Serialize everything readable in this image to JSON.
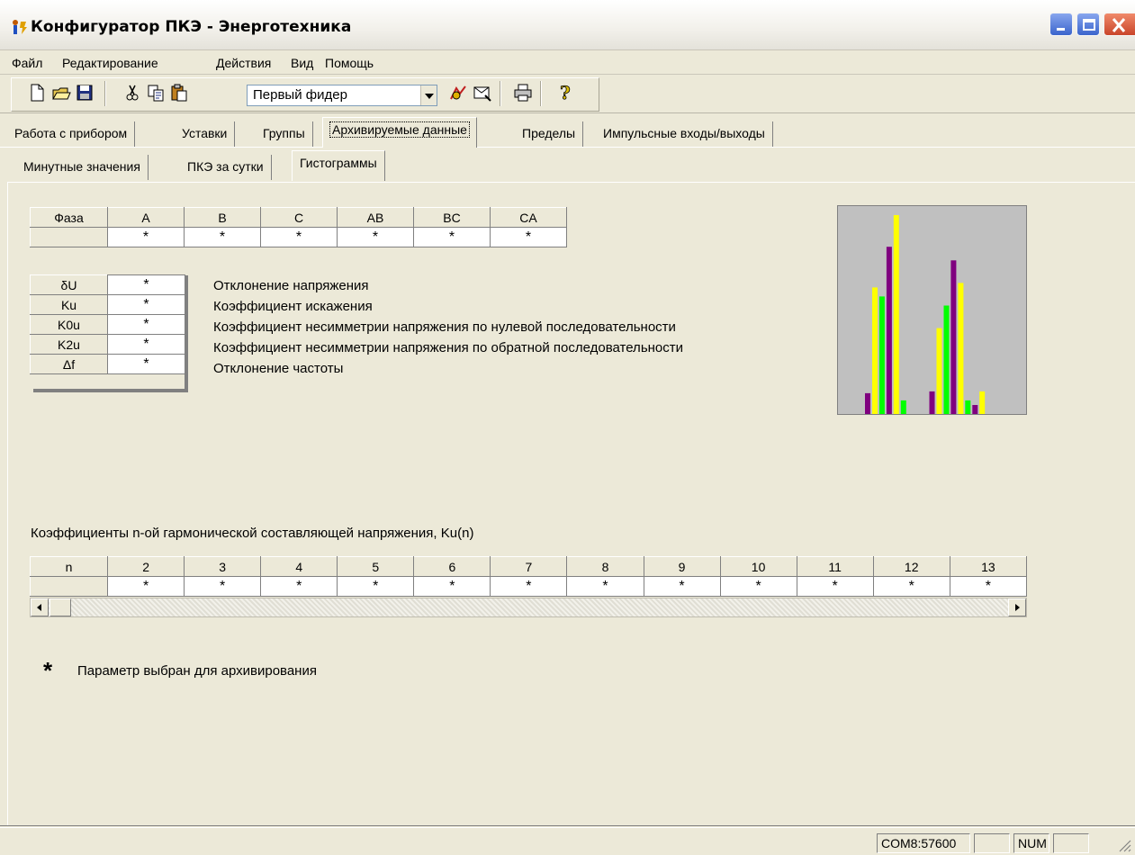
{
  "window": {
    "title": "Конфигуратор ПКЭ - Энерготехника",
    "colors": {
      "titlebar": "#f2f0ea",
      "face": "#ece9d8",
      "chart_bg": "#c0c0c0"
    }
  },
  "menu": [
    "Файл",
    "Редактирование",
    "Действия",
    "Вид",
    "Помощь"
  ],
  "toolbar": {
    "icons": [
      "new-file-icon",
      "open-folder-icon",
      "save-icon",
      "cut-icon",
      "copy-icon",
      "paste-icon",
      "connect-icon",
      "read-device-icon",
      "print-icon",
      "help-icon"
    ],
    "feeder_selected": "Первый фидер"
  },
  "tabs_main": [
    "Работа с прибором",
    "Уставки",
    "Группы",
    "Архивируемые данные",
    "Пределы",
    "Импульсные входы/выходы"
  ],
  "tabs_main_active": "Архивируемые данные",
  "tabs_sub": [
    "Минутные значения",
    "ПКЭ за сутки",
    "Гистограммы"
  ],
  "tabs_sub_active": "Гистограммы",
  "phase_table": {
    "header_label": "Фаза",
    "columns": [
      "A",
      "B",
      "C",
      "AB",
      "BC",
      "CA"
    ],
    "values": [
      "*",
      "*",
      "*",
      "*",
      "*",
      "*"
    ]
  },
  "params": [
    {
      "code": "δU",
      "value": "*",
      "description": "Отклонение напряжения"
    },
    {
      "code": "Ku",
      "value": "*",
      "description": "Коэффициент искажения"
    },
    {
      "code": "K0u",
      "value": "*",
      "description": "Коэффициент несимметрии напряжения по нулевой последовательности"
    },
    {
      "code": "K2u",
      "value": "*",
      "description": "Коэффициент несимметрии напряжения по обратной последовательности"
    },
    {
      "code": "Δf",
      "value": "*",
      "description": "Отклонение частоты"
    }
  ],
  "chart_data": {
    "type": "bar",
    "colors": [
      "#7f007f",
      "#ffff00",
      "#00ff00"
    ],
    "values": [
      23,
      140,
      130,
      185,
      220,
      15,
      0,
      0,
      0,
      25,
      95,
      120,
      170,
      145,
      15,
      10,
      25
    ]
  },
  "harmonics": {
    "caption": "Коэффициенты n-ой гармонической составляющей напряжения, Ku(n)",
    "header_label": "n",
    "columns": [
      "2",
      "3",
      "4",
      "5",
      "6",
      "7",
      "8",
      "9",
      "10",
      "11",
      "12",
      "13"
    ],
    "values": [
      "*",
      "*",
      "*",
      "*",
      "*",
      "*",
      "*",
      "*",
      "*",
      "*",
      "*",
      "*"
    ]
  },
  "legend": {
    "star": "*",
    "text": "Параметр выбран для архивирования"
  },
  "status": {
    "port": "COM8:57600",
    "num": "NUM"
  }
}
